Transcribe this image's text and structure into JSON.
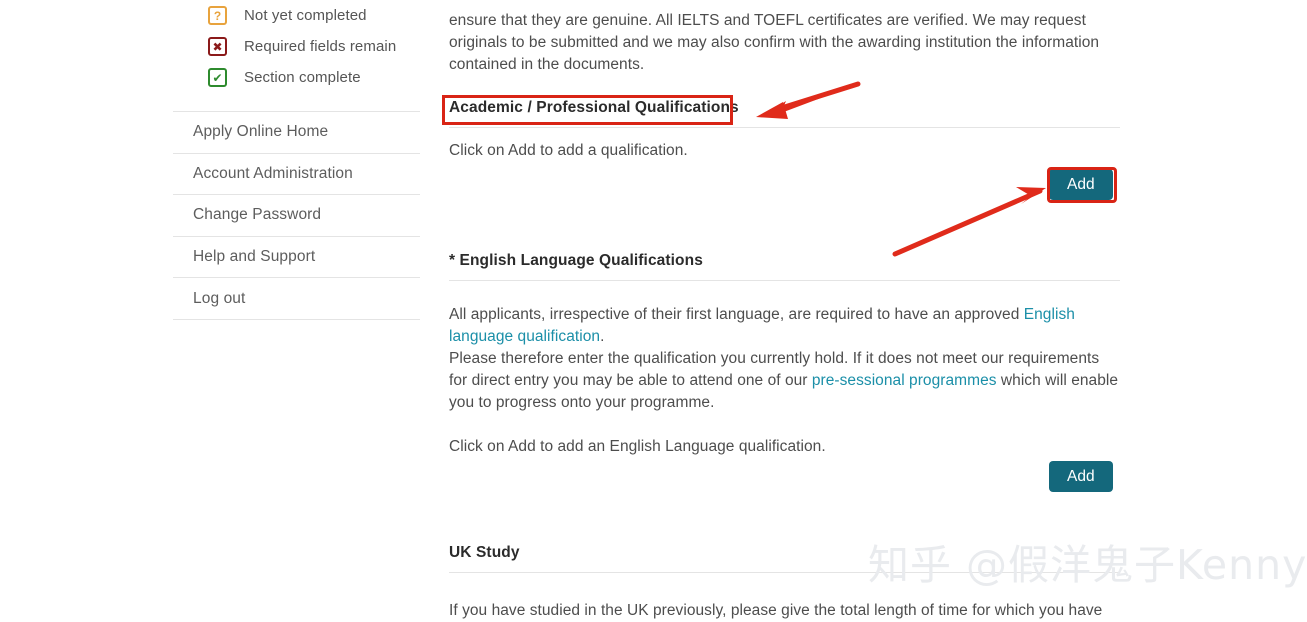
{
  "sidebar": {
    "legend": [
      {
        "icon": "question-mark-icon",
        "glyph": "?",
        "label": "Not yet completed"
      },
      {
        "icon": "cross-mark-icon",
        "glyph": "✖",
        "label": "Required fields remain"
      },
      {
        "icon": "check-mark-icon",
        "glyph": "✔",
        "label": "Section complete"
      }
    ],
    "nav_items": [
      {
        "label": "Apply Online Home"
      },
      {
        "label": "Account Administration"
      },
      {
        "label": "Change Password"
      },
      {
        "label": "Help and Support"
      },
      {
        "label": "Log out"
      }
    ]
  },
  "main": {
    "intro_paragraph": "ensure that they are genuine. All IELTS and TOEFL certificates are verified. We may request originals to be submitted and we may also confirm with the awarding institution the information contained in the documents.",
    "academic_section": {
      "heading": "Academic / Professional Qualifications",
      "instruction": "Click on Add to add a qualification.",
      "add_label": "Add"
    },
    "english_section": {
      "heading": "* English Language Qualifications",
      "paragraph1_before_link": "All applicants, irrespective of their first language, are required to have an approved ",
      "paragraph1_link": "English language qualification",
      "paragraph1_after_link": ".",
      "paragraph2_before_link": "Please therefore enter the qualification you currently hold. If it does not meet our requirements for direct entry you may be able to attend one of our ",
      "paragraph2_link": "pre-sessional programmes",
      "paragraph2_after_link": " which will enable you to progress onto your programme.",
      "instruction": "Click on Add to add an English Language qualification.",
      "add_label": "Add"
    },
    "uk_study_section": {
      "heading": "UK Study",
      "paragraph": "If you have studied in the UK previously, please give the total length of time for which you have"
    }
  },
  "annotations": {
    "highlight_color": "#d92415",
    "arrow_color": "#e02b1b",
    "highlighted_heading": "Academic / Professional Qualifications",
    "highlighted_button": "Add"
  },
  "watermark": {
    "text": "知乎 @假洋鬼子Kenny"
  },
  "colors": {
    "accent_teal": "#14687c",
    "link_teal": "#1b8fa8",
    "pending_orange": "#e8a33d",
    "required_dark_red": "#8b1a1a",
    "complete_green": "#2e8b2e"
  }
}
